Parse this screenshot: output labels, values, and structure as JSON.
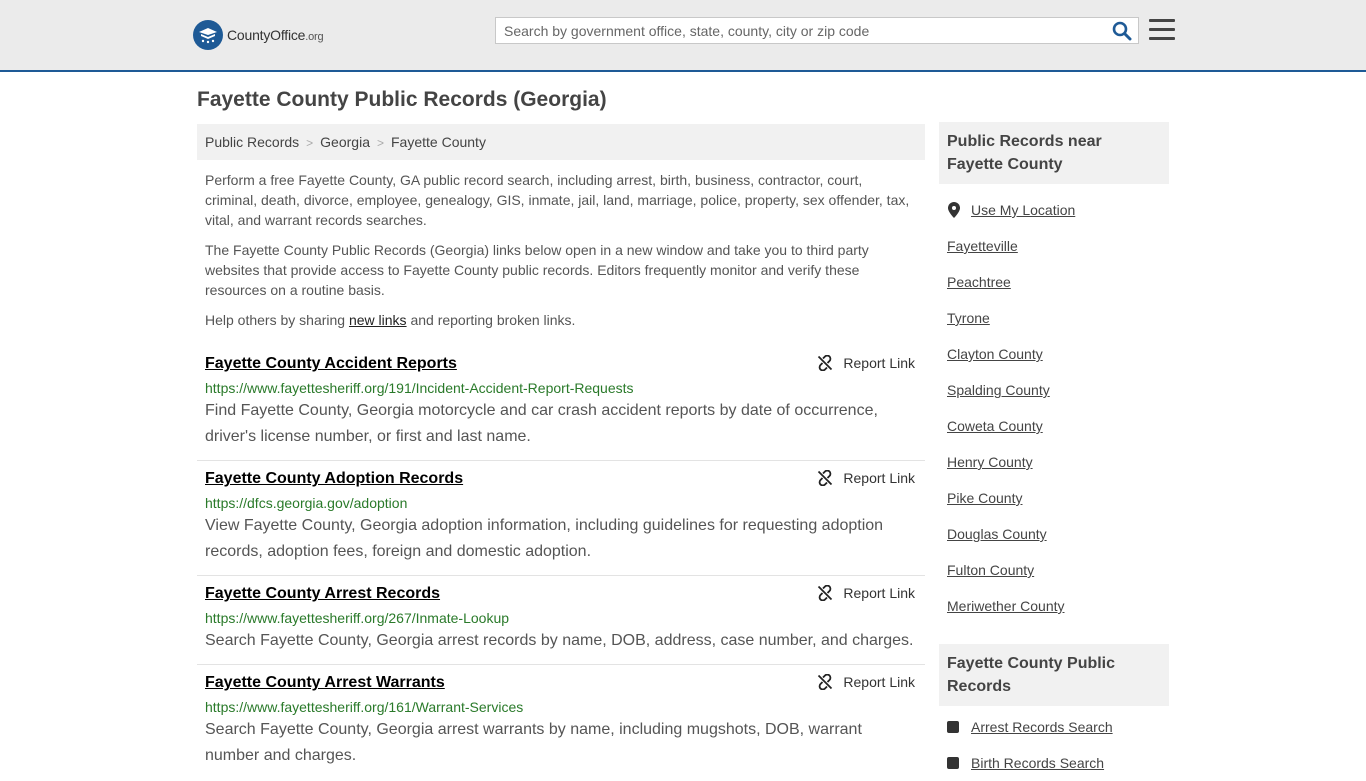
{
  "header": {
    "logo_main": "CountyOffice",
    "logo_suffix": ".org",
    "search_placeholder": "Search by government office, state, county, city or zip code"
  },
  "page_title": "Fayette County Public Records (Georgia)",
  "breadcrumb": [
    "Public Records",
    "Georgia",
    "Fayette County"
  ],
  "intro": {
    "p1": "Perform a free Fayette County, GA public record search, including arrest, birth, business, contractor, court, criminal, death, divorce, employee, genealogy, GIS, inmate, jail, land, marriage, police, property, sex offender, tax, vital, and warrant records searches.",
    "p2": "The Fayette County Public Records (Georgia) links below open in a new window and take you to third party websites that provide access to Fayette County public records. Editors frequently monitor and verify these resources on a routine basis.",
    "p3_before": "Help others by sharing ",
    "p3_link": "new links",
    "p3_after": " and reporting broken links."
  },
  "report_label": "Report Link",
  "records": [
    {
      "title": "Fayette County Accident Reports",
      "url": "https://www.fayettesheriff.org/191/Incident-Accident-Report-Requests",
      "desc": "Find Fayette County, Georgia motorcycle and car crash accident reports by date of occurrence, driver's license number, or first and last name."
    },
    {
      "title": "Fayette County Adoption Records",
      "url": "https://dfcs.georgia.gov/adoption",
      "desc": "View Fayette County, Georgia adoption information, including guidelines for requesting adoption records, adoption fees, foreign and domestic adoption."
    },
    {
      "title": "Fayette County Arrest Records",
      "url": "https://www.fayettesheriff.org/267/Inmate-Lookup",
      "desc": "Search Fayette County, Georgia arrest records by name, DOB, address, case number, and charges."
    },
    {
      "title": "Fayette County Arrest Warrants",
      "url": "https://www.fayettesheriff.org/161/Warrant-Services",
      "desc": "Search Fayette County, Georgia arrest warrants by name, including mugshots, DOB, warrant number and charges."
    }
  ],
  "sidebar": {
    "near_heading": "Public Records near Fayette County",
    "use_location": "Use My Location",
    "near_links": [
      "Fayetteville",
      "Peachtree",
      "Tyrone",
      "Clayton County",
      "Spalding County",
      "Coweta County",
      "Henry County",
      "Pike County",
      "Douglas County",
      "Fulton County",
      "Meriwether County"
    ],
    "records_heading": "Fayette County Public Records",
    "record_links": [
      "Arrest Records Search",
      "Birth Records Search"
    ]
  },
  "colors": {
    "accent": "#1e5a96",
    "url_green": "#2a7a2a",
    "header_bg": "#ebebeb"
  }
}
